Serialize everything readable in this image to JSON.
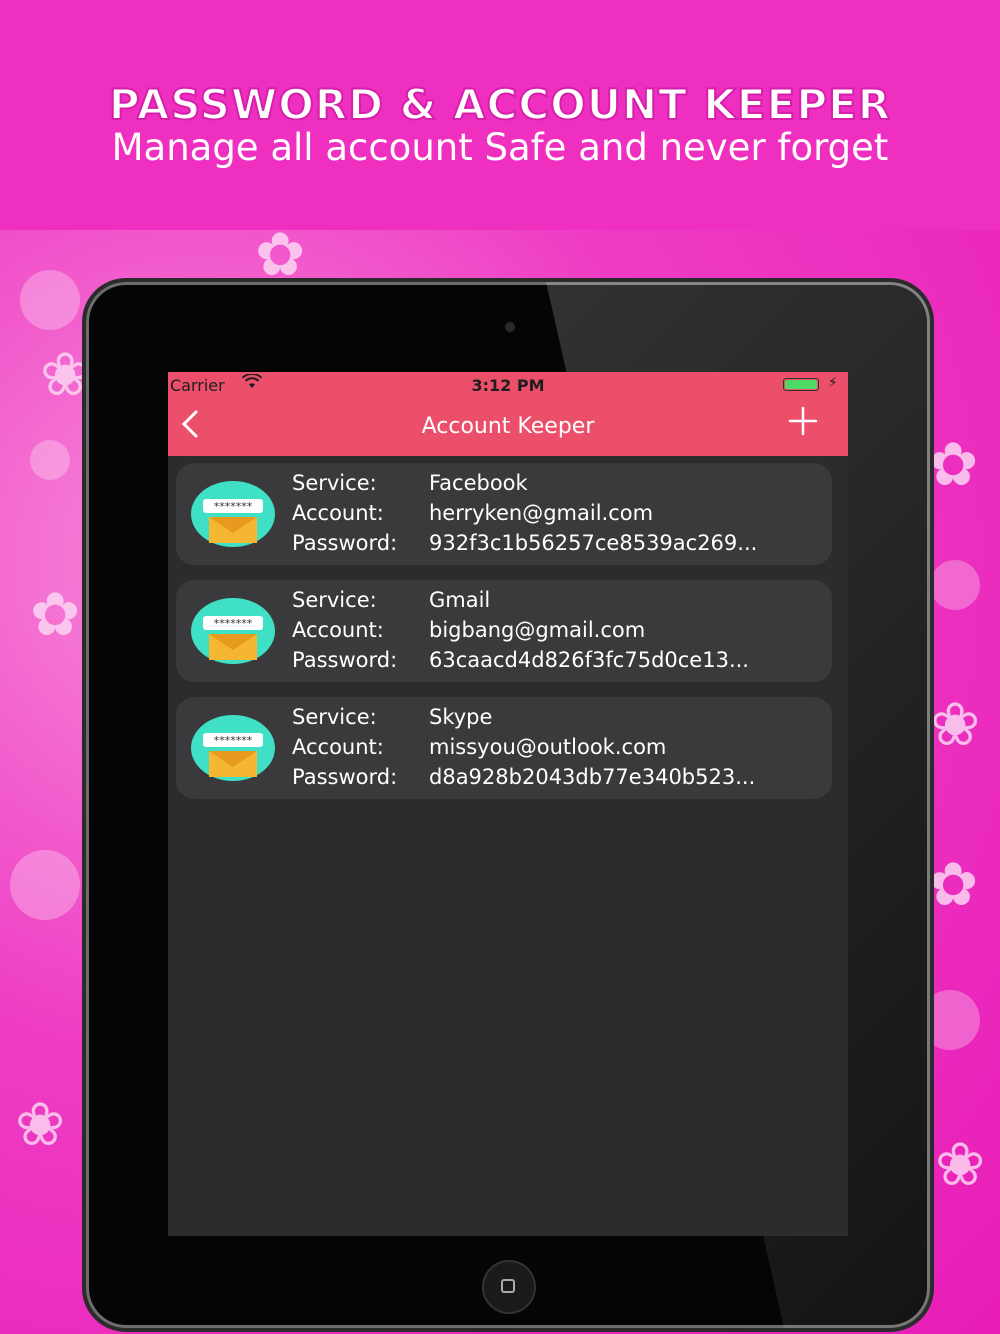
{
  "banner": {
    "title": "PASSWORD & ACCOUNT KEEPER",
    "subtitle": "Manage all account Safe and never forget"
  },
  "status_bar": {
    "carrier": "Carrier",
    "time": "3:12 PM"
  },
  "nav": {
    "back_icon": "chevron-left-icon",
    "title": "Account Keeper",
    "add_icon": "plus-icon"
  },
  "labels": {
    "service": "Service:",
    "account": "Account:",
    "password": "Password:"
  },
  "accounts": [
    {
      "service": "Facebook",
      "account": "herryken@gmail.com",
      "password": "932f3c1b56257ce8539ac269..."
    },
    {
      "service": "Gmail",
      "account": "bigbang@gmail.com",
      "password": "63caacd4d826f3fc75d0ce13..."
    },
    {
      "service": "Skype",
      "account": "missyou@outlook.com",
      "password": "d8a928b2043db77e340b523..."
    }
  ],
  "colors": {
    "banner": "#ef2fbf",
    "nav": "#ec4f69",
    "screen_bg": "#2c2c2e",
    "card_bg": "#3a3a3c",
    "battery": "#4cd964"
  }
}
